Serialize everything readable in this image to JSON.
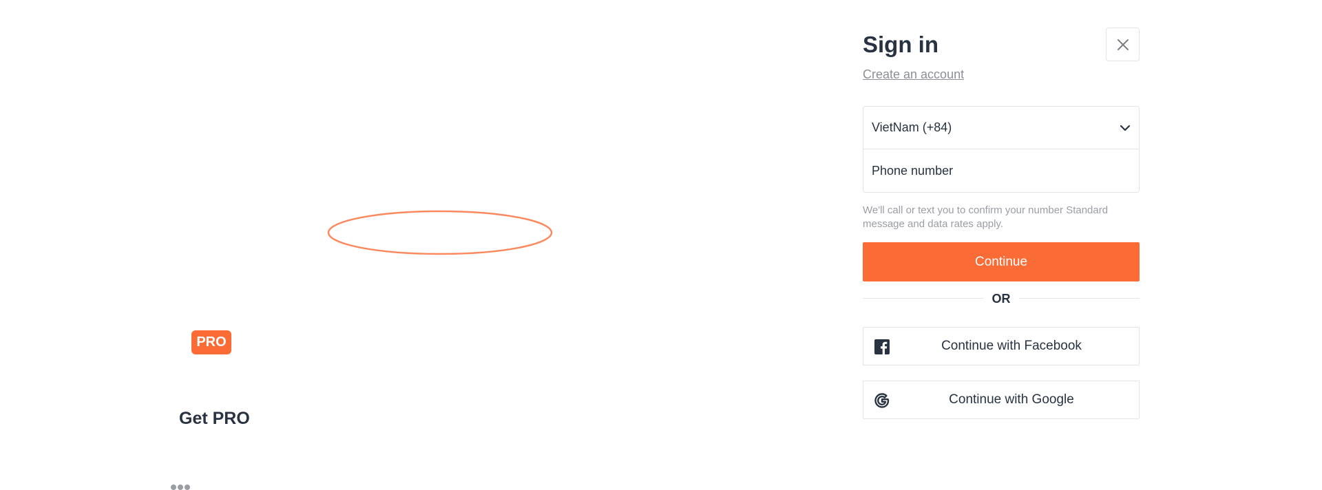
{
  "left": {
    "badge": "PRO",
    "get_pro": "Get PRO"
  },
  "signin": {
    "title": "Sign in",
    "create_account": "Create an account",
    "country_value": "VietNam (+84)",
    "phone_placeholder": "Phone number",
    "hint": "We'll call or text you to confirm your number Standard message and data rates apply.",
    "continue_label": "Continue",
    "or_label": "OR",
    "facebook_label": "Continue with Facebook",
    "google_label": "Continue with Google"
  },
  "icons": {
    "close": "close-icon",
    "chevron": "chevron-down-icon",
    "facebook": "facebook-icon",
    "google": "google-icon",
    "loader": "loading-spinner-icon",
    "more": "more-dots-icon"
  },
  "colors": {
    "accent": "#fb6b36",
    "text": "#283240",
    "muted": "#9a9ea4",
    "border": "#e2e4e7"
  }
}
